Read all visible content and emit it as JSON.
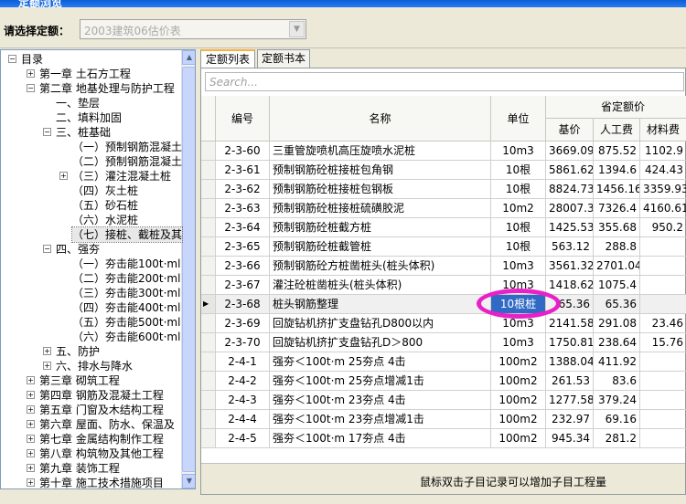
{
  "window": {
    "title": "定额浏览"
  },
  "selector": {
    "label": "请选择定额：",
    "value": "2003建筑06估价表"
  },
  "tree": [
    {
      "label": "目录",
      "depth": 0,
      "toggle": "minus"
    },
    {
      "label": "第一章  土石方工程",
      "depth": 1,
      "toggle": "plus"
    },
    {
      "label": "第二章  地基处理与防护工程",
      "depth": 1,
      "toggle": "minus"
    },
    {
      "label": "一、垫层",
      "depth": 2,
      "toggle": ""
    },
    {
      "label": "二、填料加固",
      "depth": 2,
      "toggle": ""
    },
    {
      "label": "三、桩基础",
      "depth": 2,
      "toggle": "minus"
    },
    {
      "label": "（一）预制钢筋混凝土",
      "depth": 3,
      "toggle": ""
    },
    {
      "label": "（二）预制钢筋混凝土",
      "depth": 3,
      "toggle": ""
    },
    {
      "label": "（三）灌注混凝土桩",
      "depth": 3,
      "toggle": "plus"
    },
    {
      "label": "（四）灰土桩",
      "depth": 3,
      "toggle": ""
    },
    {
      "label": "（五）砂石桩",
      "depth": 3,
      "toggle": ""
    },
    {
      "label": "（六）水泥桩",
      "depth": 3,
      "toggle": ""
    },
    {
      "label": "（七）接桩、截桩及其",
      "depth": 3,
      "toggle": "",
      "selected": true
    },
    {
      "label": "四、强夯",
      "depth": 2,
      "toggle": "minus"
    },
    {
      "label": "（一）夯击能100t·ml",
      "depth": 3,
      "toggle": ""
    },
    {
      "label": "（二）夯击能200t·ml",
      "depth": 3,
      "toggle": ""
    },
    {
      "label": "（三）夯击能300t·ml",
      "depth": 3,
      "toggle": ""
    },
    {
      "label": "（四）夯击能400t·ml",
      "depth": 3,
      "toggle": ""
    },
    {
      "label": "（五）夯击能500t·ml",
      "depth": 3,
      "toggle": ""
    },
    {
      "label": "（六）夯击能600t·ml",
      "depth": 3,
      "toggle": ""
    },
    {
      "label": "五、防护",
      "depth": 2,
      "toggle": "plus"
    },
    {
      "label": "六、排水与降水",
      "depth": 2,
      "toggle": "plus"
    },
    {
      "label": "第三章  砌筑工程",
      "depth": 1,
      "toggle": "plus"
    },
    {
      "label": "第四章  钢筋及混凝土工程",
      "depth": 1,
      "toggle": "plus"
    },
    {
      "label": "第五章  门窗及木结构工程",
      "depth": 1,
      "toggle": "plus"
    },
    {
      "label": "第六章  屋面、防水、保温及",
      "depth": 1,
      "toggle": "plus"
    },
    {
      "label": "第七章  金属结构制作工程",
      "depth": 1,
      "toggle": "plus"
    },
    {
      "label": "第八章  构筑物及其他工程",
      "depth": 1,
      "toggle": "plus"
    },
    {
      "label": "第九章  装饰工程",
      "depth": 1,
      "toggle": "plus"
    },
    {
      "label": "第十章  施工技术措施项目",
      "depth": 1,
      "toggle": "plus"
    }
  ],
  "tabs": [
    {
      "label": "定额列表"
    },
    {
      "label": "定额书本"
    }
  ],
  "search": {
    "placeholder": "Search..."
  },
  "table": {
    "headers": {
      "code": "编号",
      "name": "名称",
      "unit": "单位",
      "group": "省定额价",
      "base": "基价",
      "labor": "人工费",
      "material": "材料费"
    },
    "rows": [
      {
        "code": "2-3-60",
        "name": "三重管旋喷机高压旋喷水泥桩",
        "unit": "10m3",
        "base": "3669.09",
        "labor": "875.52",
        "material": "1102.9"
      },
      {
        "code": "2-3-61",
        "name": "预制钢筋砼桩接桩包角钢",
        "unit": "10根",
        "base": "5861.62",
        "labor": "1394.6",
        "material": "424.43"
      },
      {
        "code": "2-3-62",
        "name": "预制钢筋砼桩接桩包钢板",
        "unit": "10根",
        "base": "8824.73",
        "labor": "1456.16",
        "material": "3359.93"
      },
      {
        "code": "2-3-63",
        "name": "预制钢筋砼桩接桩硫磺胶泥",
        "unit": "10m2",
        "base": "28007.36",
        "labor": "7326.4",
        "material": "4160.61"
      },
      {
        "code": "2-3-64",
        "name": "预制钢筋砼桩截方桩",
        "unit": "10根",
        "base": "1425.53",
        "labor": "355.68",
        "material": "950.2"
      },
      {
        "code": "2-3-65",
        "name": "预制钢筋砼桩截管桩",
        "unit": "10根",
        "base": "563.12",
        "labor": "288.8",
        "material": ""
      },
      {
        "code": "2-3-66",
        "name": "预制钢筋砼方桩凿桩头(桩头体积)",
        "unit": "10m3",
        "base": "3561.32",
        "labor": "2701.04",
        "material": ""
      },
      {
        "code": "2-3-67",
        "name": "灌注砼桩凿桩头(桩头体积)",
        "unit": "10m3",
        "base": "1418.62",
        "labor": "1075.4",
        "material": ""
      },
      {
        "code": "2-3-68",
        "name": "桩头钢筋整理",
        "unit": "10根桩",
        "base": "65.36",
        "labor": "65.36",
        "material": "",
        "selected": true
      },
      {
        "code": "2-3-69",
        "name": "回旋钻机挤扩支盘钻孔D800以内",
        "unit": "10m3",
        "base": "2141.58",
        "labor": "291.08",
        "material": "23.46"
      },
      {
        "code": "2-3-70",
        "name": "回旋钻机挤扩支盘钻孔D＞800",
        "unit": "10m3",
        "base": "1750.81",
        "labor": "238.64",
        "material": "15.76"
      },
      {
        "code": "2-4-1",
        "name": "强夯＜100t·m 25夯点 4击",
        "unit": "100m2",
        "base": "1388.04",
        "labor": "411.92",
        "material": ""
      },
      {
        "code": "2-4-2",
        "name": "强夯＜100t·m 25夯点增减1击",
        "unit": "100m2",
        "base": "261.53",
        "labor": "83.6",
        "material": ""
      },
      {
        "code": "2-4-3",
        "name": "强夯＜100t·m 23夯点 4击",
        "unit": "100m2",
        "base": "1277.58",
        "labor": "379.24",
        "material": ""
      },
      {
        "code": "2-4-4",
        "name": "强夯＜100t·m 23夯点增减1击",
        "unit": "100m2",
        "base": "232.97",
        "labor": "69.16",
        "material": ""
      },
      {
        "code": "2-4-5",
        "name": "强夯＜100t·m 17夯点 4击",
        "unit": "100m2",
        "base": "945.34",
        "labor": "281.2",
        "material": ""
      }
    ]
  },
  "footer": {
    "hint": "鼠标双击子目记录可以增加子目工程量"
  }
}
